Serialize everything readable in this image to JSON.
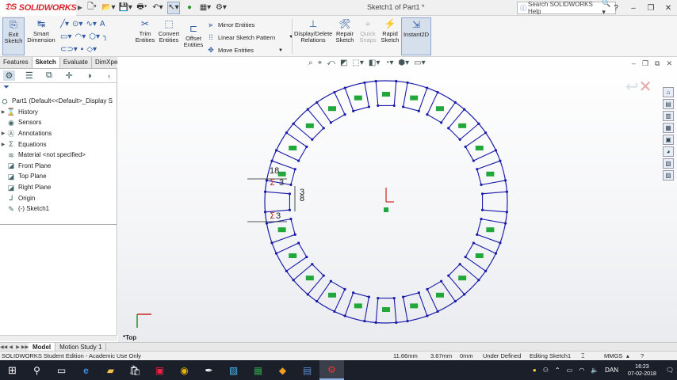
{
  "titlebar": {
    "app_name": "SOLIDWORKS",
    "doc_title": "Sketch1 of Part1 *",
    "help_search_placeholder": "Search SOLIDWORKS Help",
    "help_label": "?"
  },
  "commands": {
    "exit_sketch": "Exit Sketch",
    "smart_dimension": "Smart Dimension",
    "trim_entities": "Trim Entities",
    "convert_entities": "Convert Entities",
    "offset_entities": "Offset Entities",
    "mirror_entities": "Mirror Entities",
    "linear_sketch_pattern": "Linear Sketch Pattern",
    "move_entities": "Move Entities",
    "display_delete_relations": "Display/Delete Relations",
    "repair_sketch": "Repair Sketch",
    "quick_snaps": "Quick Snaps",
    "rapid_sketch": "Rapid Sketch",
    "instant2d": "Instant2D"
  },
  "cm_tabs": [
    "Features",
    "Sketch",
    "Evaluate",
    "DimXpert"
  ],
  "tree": {
    "root": "Part1  (Default<<Default>_Display S",
    "items": [
      {
        "label": "History",
        "icon": "history-icon",
        "expandable": true
      },
      {
        "label": "Sensors",
        "icon": "sensor-icon",
        "expandable": false
      },
      {
        "label": "Annotations",
        "icon": "annotation-icon",
        "expandable": true
      },
      {
        "label": "Equations",
        "icon": "equation-icon",
        "expandable": true
      },
      {
        "label": "Material <not specified>",
        "icon": "material-icon",
        "expandable": false
      },
      {
        "label": "Front Plane",
        "icon": "plane-icon",
        "expandable": false
      },
      {
        "label": "Top Plane",
        "icon": "plane-icon",
        "expandable": false
      },
      {
        "label": "Right Plane",
        "icon": "plane-icon",
        "expandable": false
      },
      {
        "label": "Origin",
        "icon": "origin-icon",
        "expandable": false
      },
      {
        "label": "(-) Sketch1",
        "icon": "sketch-icon",
        "expandable": false
      }
    ]
  },
  "bottom_tabs": [
    "Model",
    "Motion Study 1"
  ],
  "status": {
    "edition": "SOLIDWORKS Student Edition - Academic Use Only",
    "x": "11.66mm",
    "y": "3.67mm",
    "z": "0mm",
    "definition": "Under Defined",
    "editing": "Editing Sketch1",
    "units": "MMGS"
  },
  "taskbar": {
    "time": "16:23",
    "date": "07-02-2018",
    "lang": "DAN"
  },
  "sketch": {
    "view_label": "*Top",
    "dim_labels": [
      "18",
      "3",
      "3",
      "8",
      "3"
    ],
    "relation_tag": "ON0",
    "segments": 24,
    "colors": {
      "sketch": "#1a1aa8",
      "point": "#1a1aa8",
      "dimension": "#222222",
      "relation": "#22a83a",
      "origin": "#cc2222"
    }
  }
}
